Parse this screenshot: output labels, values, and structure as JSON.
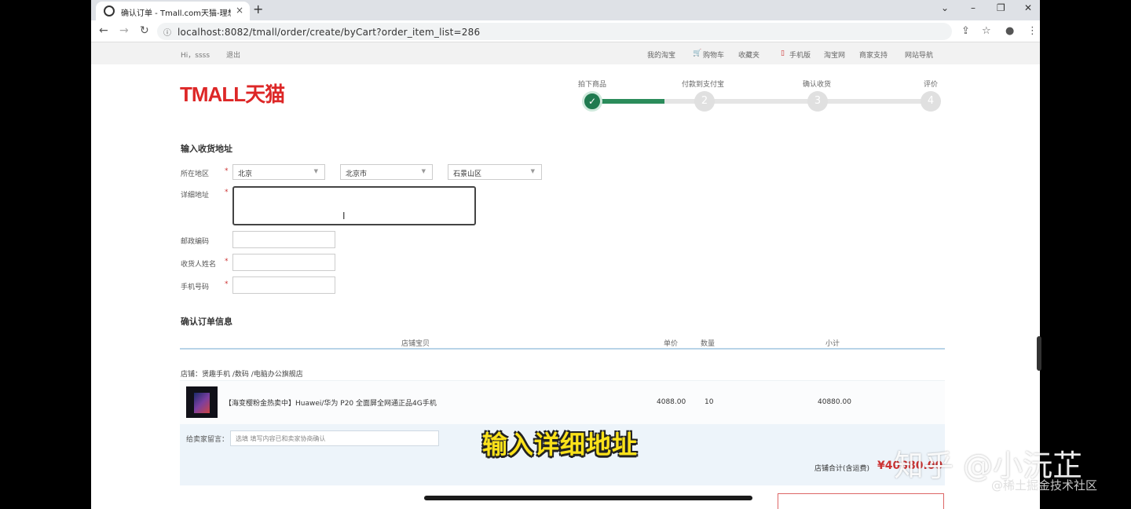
{
  "browser": {
    "tab_title": "确认订单 - Tmall.com天猫-理想",
    "tab_close": "×",
    "new_tab": "+",
    "url": "localhost:8082/tmall/order/create/byCart?order_item_list=286",
    "window_controls": [
      "⌄",
      "–",
      "❐",
      "✕"
    ],
    "nav_icons": [
      "back-arrow-icon",
      "forward-arrow-icon",
      "reload-icon"
    ],
    "toolbar_icons": [
      "share-icon",
      "star-icon",
      "profile-icon",
      "menu-icon"
    ]
  },
  "site_bar": {
    "greeting": "Hi，ssss",
    "logout": "退出",
    "links": [
      "我的淘宝",
      "购物车",
      "收藏夹",
      "手机版",
      "淘宝网",
      "商家支持",
      "网站导航"
    ]
  },
  "logo": "TMALL天猫",
  "steps": [
    {
      "label": "拍下商品",
      "number": "✓",
      "done": true
    },
    {
      "label": "付款到支付宝",
      "number": "2",
      "done": false
    },
    {
      "label": "确认收货",
      "number": "3",
      "done": false
    },
    {
      "label": "评价",
      "number": "4",
      "done": false
    }
  ],
  "address_form": {
    "title": "输入收货地址",
    "region_label": "所在地区",
    "province": "北京",
    "city": "北京市",
    "district": "石景山区",
    "detail_label": "详细地址",
    "postcode_label": "邮政编码",
    "receiver_label": "收货人姓名",
    "phone_label": "手机号码",
    "required_mark": "*"
  },
  "order": {
    "title": "确认订单信息",
    "columns": [
      "店铺宝贝",
      "单价",
      "数量",
      "小计"
    ],
    "shop": "店铺：贤趣手机 /数码 /电脑办公旗舰店",
    "item": {
      "name": "【海变樱粉金热卖中】Huawei/华为 P20 全面屏全网通正品4G手机",
      "price": "4088.00",
      "quantity": "10",
      "subtotal": "40880.00"
    },
    "message_label": "给卖家留言：",
    "message_placeholder": "选填 填写内容已和卖家协商确认",
    "total_label": "店铺合计(含运费)",
    "total": "¥40880.00"
  },
  "overlay": {
    "caption": "输入详细地址",
    "watermark_main": "知乎 @小沅芷",
    "watermark_sub": "@稀土掘金技术社区"
  }
}
